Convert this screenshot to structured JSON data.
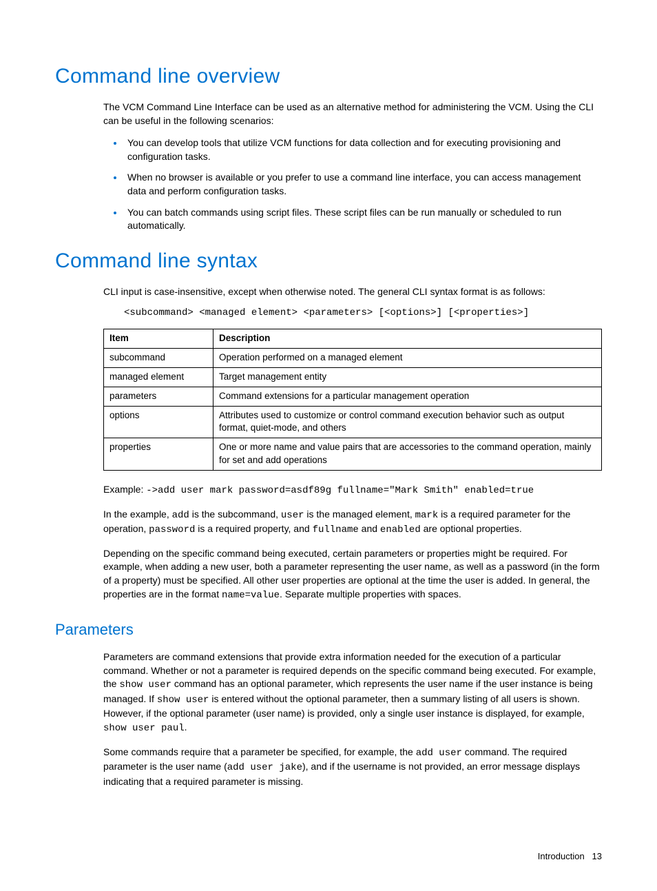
{
  "h1_overview": "Command line overview",
  "overview_intro": "The VCM Command Line Interface can be used as an alternative method for administering the VCM. Using the CLI can be useful in the following scenarios:",
  "overview_bullets": [
    "You can develop tools that utilize VCM functions for data collection and for executing provisioning and configuration tasks.",
    "When no browser is available or you prefer to use a command line interface, you can access management data and perform configuration tasks.",
    "You can batch commands using script files. These script files can be run manually or scheduled to run automatically."
  ],
  "h1_syntax": "Command line syntax",
  "syntax_intro": "CLI input is case-insensitive, except when otherwise noted. The general CLI syntax format is as follows:",
  "syntax_code": "<subcommand> <managed element> <parameters> [<options>] [<properties>]",
  "table": {
    "headers": [
      "Item",
      "Description"
    ],
    "rows": [
      [
        "subcommand",
        "Operation performed on a managed element"
      ],
      [
        "managed element",
        "Target management entity"
      ],
      [
        "parameters",
        "Command extensions for a particular management operation"
      ],
      [
        "options",
        "Attributes used to customize or control command execution behavior such as output format, quiet-mode, and others"
      ],
      [
        "properties",
        "One or more name and value pairs that are accessories to the command operation, mainly for set and add operations"
      ]
    ]
  },
  "example_label": "Example: ",
  "example_code": "->add user mark password=asdf89g fullname=\"Mark Smith\" enabled=true",
  "example_p1_a": "In the example, ",
  "example_p1_c1": "add",
  "example_p1_b": " is the subcommand, ",
  "example_p1_c2": "user",
  "example_p1_c": " is the managed element, ",
  "example_p1_c3": "mark",
  "example_p1_d": " is a required parameter for the operation, ",
  "example_p1_c4": "password",
  "example_p1_e": " is a required property, and ",
  "example_p1_c5": "fullname",
  "example_p1_f": " and ",
  "example_p1_c6": "enabled",
  "example_p1_g": " are optional properties.",
  "example_p2_a": "Depending on the specific command being executed, certain parameters or properties might be required. For example, when adding a new user, both a parameter representing the user name, as well as a password (in the form of a property) must be specified. All other user properties are optional at the time the user is added. In general, the properties are in the format ",
  "example_p2_c1": "name=value",
  "example_p2_b": ". Separate multiple properties with spaces.",
  "h2_parameters": "Parameters",
  "params_p1_a": "Parameters are command extensions that provide extra information needed for the execution of a particular command. Whether or not a parameter is required depends on the specific command being executed. For example, the ",
  "params_p1_c1": "show user",
  "params_p1_b": " command has an optional parameter, which represents the user name if the user instance is being managed. If ",
  "params_p1_c2": "show user",
  "params_p1_c": " is entered without the optional parameter, then a summary listing of all users is shown. However, if the optional parameter (user name) is provided, only a single user instance is displayed, for example, ",
  "params_p1_c3": "show user paul",
  "params_p1_d": ".",
  "params_p2_a": "Some commands require that a parameter be specified, for example, the ",
  "params_p2_c1": "add user",
  "params_p2_b": " command. The required parameter is the user name (",
  "params_p2_c2": "add user jake",
  "params_p2_c": "), and if the username is not provided, an error message displays indicating that a required parameter is missing.",
  "footer_label": "Introduction",
  "footer_page": "13"
}
